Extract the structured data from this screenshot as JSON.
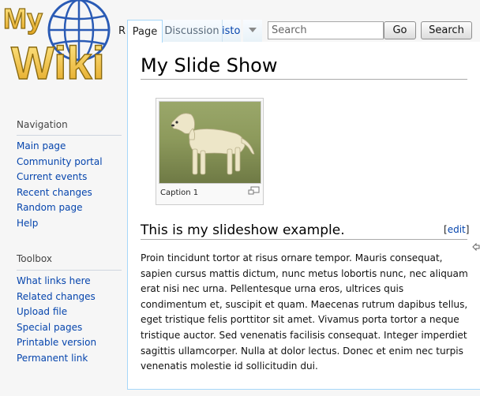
{
  "logo": {
    "text_top": "My",
    "text_bottom": "Wiki"
  },
  "tabs": {
    "clipped_tab": "R",
    "page": "Page",
    "discussion": "Discussion",
    "history": "istory"
  },
  "search": {
    "placeholder": "Search",
    "go_label": "Go",
    "search_label": "Search"
  },
  "sidebar": {
    "navigation": {
      "heading": "Navigation",
      "items": [
        "Main page",
        "Community portal",
        "Current events",
        "Recent changes",
        "Random page",
        "Help"
      ]
    },
    "toolbox": {
      "heading": "Toolbox",
      "items": [
        "What links here",
        "Related changes",
        "Upload file",
        "Special pages",
        "Printable version",
        "Permanent link"
      ]
    }
  },
  "content": {
    "title": "My Slide Show",
    "thumb_caption": "Caption 1",
    "section_heading": "This is my slideshow example.",
    "edit_label": "edit",
    "paragraph": "Proin tincidunt tortor at risus ornare tempor. Mauris consequat, sapien cursus mattis dictum, nunc metus lobortis nunc, nec aliquam erat nisi nec urna. Pellentesque urna eros, ultrices quis condimentum et, suscipit et quam. Maecenas rutrum dapibus tellus, eget tristique felis porttitor sit amet. Vivamus porta tortor a neque tristique auctor. Sed venenatis facilisis consequat. Integer imperdiet sagittis ullamcorper. Nulla at dolor lectus. Donec et enim nec turpis venenatis molestie id sollicitudin dui."
  },
  "colors": {
    "link": "#0645ad",
    "tab_border": "#a7d7f9",
    "logo_gold": "#f2c94c",
    "globe_blue": "#2a5bb5"
  }
}
